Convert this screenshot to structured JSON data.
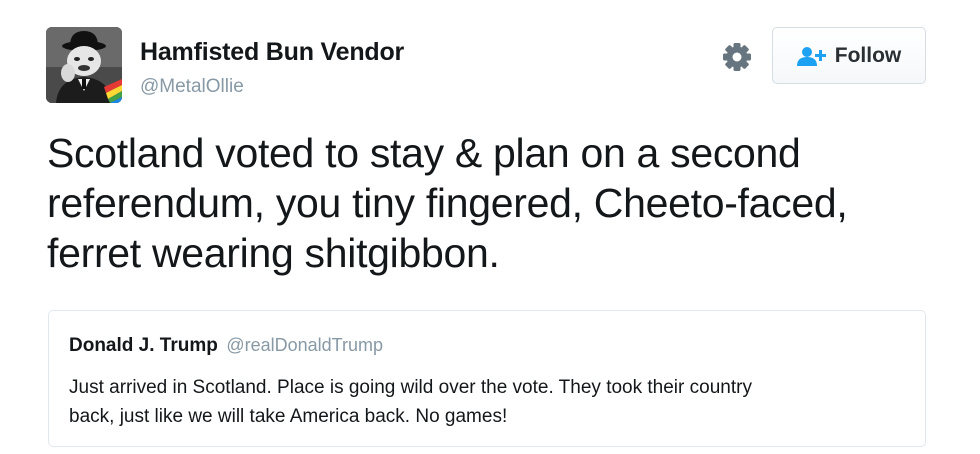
{
  "author": {
    "display_name": "Hamfisted Bun Vendor",
    "handle": "@MetalOllie",
    "avatar_icon": "avatar-photo"
  },
  "actions": {
    "settings_icon": "gear-icon",
    "follow_label": "Follow",
    "follow_icon": "add-user-icon",
    "follow_color": "#1da1f2"
  },
  "tweet": {
    "lines": [
      "Scotland voted to stay & plan on a second",
      "referendum, you tiny fingered, Cheeto-faced,",
      "ferret wearing shitgibbon."
    ]
  },
  "quoted_tweet": {
    "display_name": "Donald J. Trump",
    "handle": "@realDonaldTrump",
    "lines": [
      "Just arrived in Scotland. Place is going wild over the vote. They took their country",
      "back, just like we will take America back. No games!"
    ]
  }
}
